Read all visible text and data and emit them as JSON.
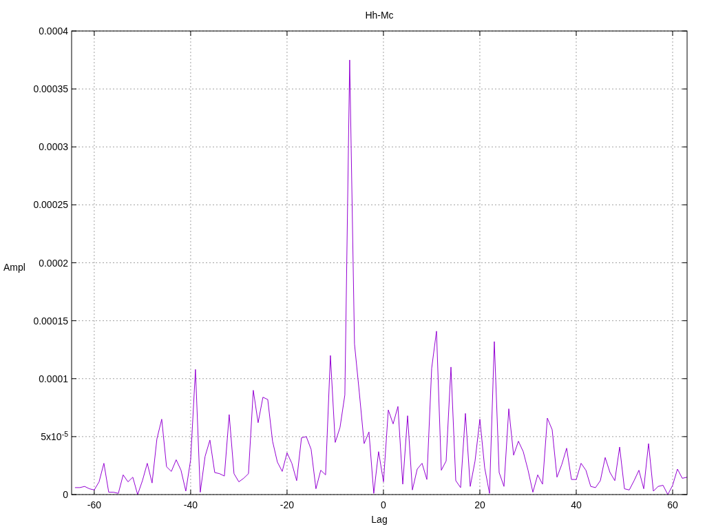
{
  "chart_data": {
    "type": "line",
    "title": "Hh-Mc",
    "xlabel": "Lag",
    "ylabel": "Ampl",
    "xlim": [
      -64.7,
      63
    ],
    "ylim": [
      0,
      0.0004
    ],
    "grid": true,
    "xticks": [
      -60,
      -40,
      -20,
      0,
      20,
      40,
      60
    ],
    "yticks": [
      0,
      {
        "value": 5e-05,
        "label": "5x10$^{-5}$"
      },
      {
        "value": 0.0001,
        "label": "0.0001"
      },
      {
        "value": 0.00015,
        "label": "0.00015"
      },
      {
        "value": 0.0002,
        "label": "0.0002"
      },
      {
        "value": 0.00025,
        "label": "0.00025"
      },
      {
        "value": 0.0003,
        "label": "0.0003"
      },
      {
        "value": 0.00035,
        "label": "0.00035"
      },
      {
        "value": 0.0004,
        "label": "0.0004"
      }
    ],
    "x": [
      -64,
      -63,
      -62,
      -61,
      -60,
      -59,
      -58,
      -57,
      -56,
      -55,
      -54,
      -53,
      -52,
      -51,
      -50,
      -49,
      -48,
      -47,
      -46,
      -45,
      -44,
      -43,
      -42,
      -41,
      -40,
      -39,
      -38,
      -37,
      -36,
      -35,
      -34,
      -33,
      -32,
      -31,
      -30,
      -29,
      -28,
      -27,
      -26,
      -25,
      -24,
      -23,
      -22,
      -21,
      -20,
      -19,
      -18,
      -17,
      -16,
      -15,
      -14,
      -13,
      -12,
      -11,
      -10,
      -9,
      -8,
      -7,
      -6,
      -5,
      -4,
      -3,
      -2,
      -1,
      0,
      1,
      2,
      3,
      4,
      5,
      6,
      7,
      8,
      9,
      10,
      11,
      12,
      13,
      14,
      15,
      16,
      17,
      18,
      19,
      20,
      21,
      22,
      23,
      24,
      25,
      26,
      27,
      28,
      29,
      30,
      31,
      32,
      33,
      34,
      35,
      36,
      37,
      38,
      39,
      40,
      41,
      42,
      43,
      44,
      45,
      46,
      47,
      48,
      49,
      50,
      51,
      52,
      53,
      54,
      55,
      56,
      57,
      58,
      59,
      60,
      61,
      62,
      63
    ],
    "series": [
      {
        "color": "#9400d3",
        "values": [
          6e-06,
          6e-06,
          7e-06,
          5e-06,
          4e-06,
          1.1e-05,
          2.7e-05,
          2e-06,
          2e-06,
          1e-06,
          1.7e-05,
          1.1e-05,
          1.5e-05,
          0,
          1.2e-05,
          2.7e-05,
          1e-05,
          4.8e-05,
          6.5e-05,
          2.4e-05,
          2e-05,
          3e-05,
          2.1e-05,
          3e-06,
          3e-05,
          0.000108,
          2e-06,
          3.3e-05,
          4.7e-05,
          1.9e-05,
          1.8e-05,
          1.6e-05,
          6.9e-05,
          1.8e-05,
          1.1e-05,
          1.4e-05,
          1.8e-05,
          9e-05,
          6.2e-05,
          8.4e-05,
          8.2e-05,
          4.6e-05,
          2.8e-05,
          2e-05,
          3.6e-05,
          2.7e-05,
          1.2e-05,
          4.9e-05,
          5e-05,
          3.9e-05,
          5e-06,
          2.1e-05,
          1.7e-05,
          0.00012,
          4.5e-05,
          5.8e-05,
          8.6e-05,
          0.000375,
          0.00013,
          8.8e-05,
          4.4e-05,
          5.4e-05,
          1e-06,
          3.7e-05,
          1.1e-05,
          7.3e-05,
          6.1e-05,
          7.6e-05,
          9e-06,
          6.8e-05,
          4e-06,
          2.2e-05,
          2.7e-05,
          1.3e-05,
          0.000109,
          0.000141,
          2.1e-05,
          2.9e-05,
          0.00011,
          1.2e-05,
          6e-06,
          7e-05,
          7e-06,
          2.9e-05,
          6.5e-05,
          2.3e-05,
          1e-06,
          0.000132,
          1.9e-05,
          7e-06,
          7.4e-05,
          3.4e-05,
          4.6e-05,
          3.7e-05,
          2.1e-05,
          2e-06,
          1.7e-05,
          9e-06,
          6.6e-05,
          5.6e-05,
          1.5e-05,
          2.6e-05,
          4e-05,
          1.3e-05,
          1.3e-05,
          2.7e-05,
          2.1e-05,
          7e-06,
          6e-06,
          1.2e-05,
          3.2e-05,
          1.9e-05,
          1.2e-05,
          4.1e-05,
          5e-06,
          4e-06,
          1.2e-05,
          2.1e-05,
          5e-06,
          4.4e-05,
          3e-06,
          7e-06,
          8e-06,
          0,
          8e-06,
          2.2e-05,
          1.4e-05,
          1.5e-05
        ]
      }
    ]
  }
}
